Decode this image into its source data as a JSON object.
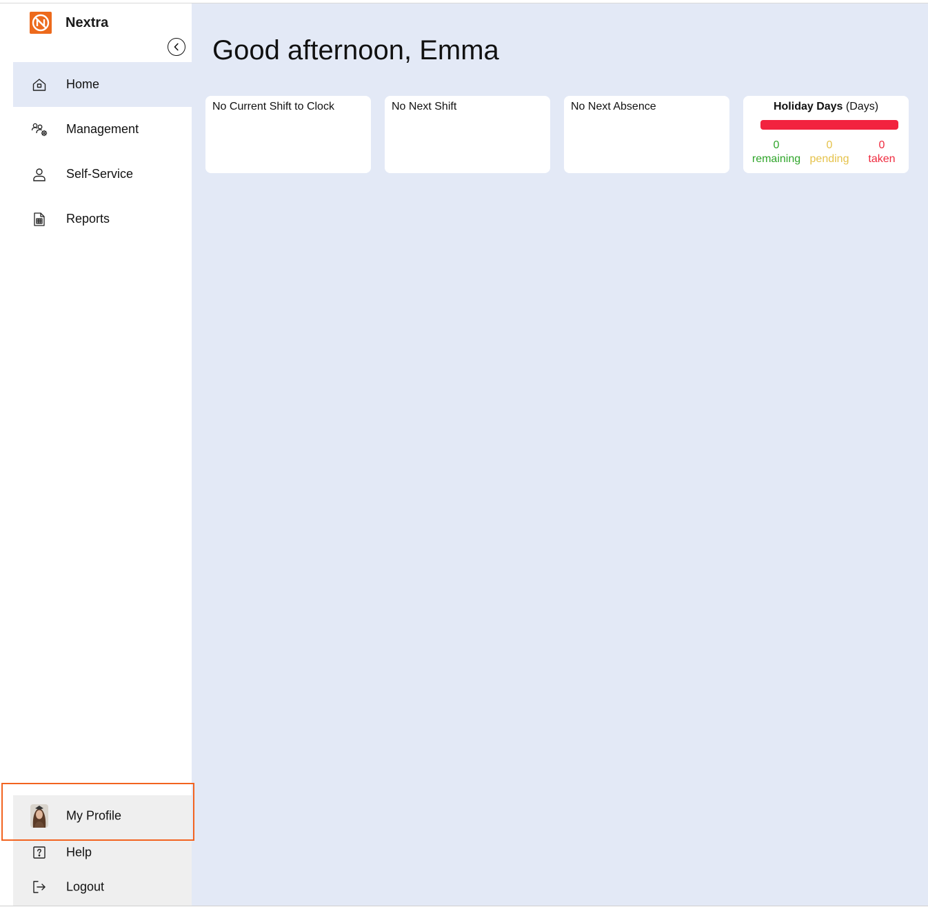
{
  "brand": {
    "name": "Nextra",
    "logo_color": "#ed6a1c"
  },
  "nav": [
    {
      "label": "Home",
      "icon": "home-icon",
      "active": true
    },
    {
      "label": "Management",
      "icon": "people-gear-icon",
      "active": false
    },
    {
      "label": "Self-Service",
      "icon": "user-icon",
      "active": false
    },
    {
      "label": "Reports",
      "icon": "report-icon",
      "active": false
    }
  ],
  "bottom_nav": [
    {
      "label": "My Profile",
      "icon": "avatar"
    },
    {
      "label": "Help",
      "icon": "help-icon"
    },
    {
      "label": "Logout",
      "icon": "logout-icon"
    }
  ],
  "greeting": "Good afternoon, Emma",
  "cards": {
    "current_shift": "No Current Shift to Clock",
    "next_shift": "No Next Shift",
    "next_absence": "No Next Absence"
  },
  "holiday": {
    "title_bold": "Holiday Days",
    "title_unit": "(Days)",
    "remaining": {
      "value": "0",
      "label": "remaining",
      "color": "#2fa52a"
    },
    "pending": {
      "value": "0",
      "label": "pending",
      "color": "#e5c24a"
    },
    "taken": {
      "value": "0",
      "label": "taken",
      "color": "#ef2a3e"
    },
    "bar_color": "#f2233f"
  },
  "colors": {
    "main_bg": "#e3e9f6",
    "highlight_border": "#f2631f"
  }
}
